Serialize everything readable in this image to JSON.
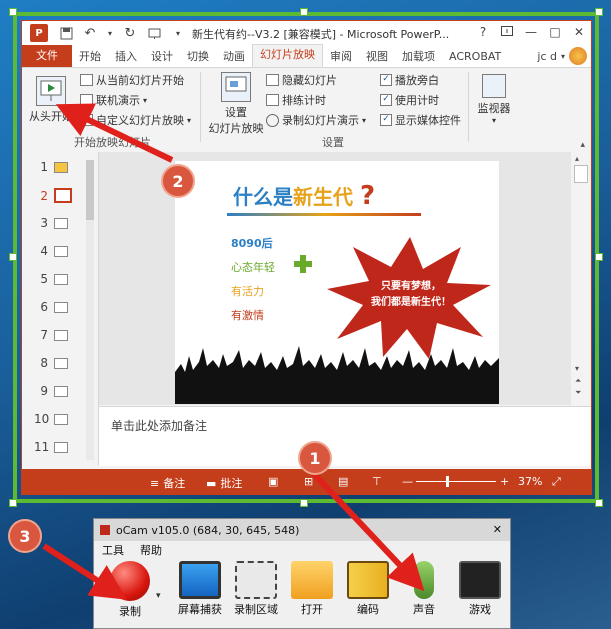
{
  "window": {
    "app_icon": "P",
    "title": "新生代有约--V3.2 [兼容模式] - Microsoft PowerP...",
    "help": "?",
    "minimize": "—",
    "maximize": "□",
    "close": "✕"
  },
  "tabs": [
    {
      "label": "文件"
    },
    {
      "label": "开始"
    },
    {
      "label": "插入"
    },
    {
      "label": "设计"
    },
    {
      "label": "切换"
    },
    {
      "label": "动画"
    },
    {
      "label": "幻灯片放映"
    },
    {
      "label": "审阅"
    },
    {
      "label": "视图"
    },
    {
      "label": "加载项"
    },
    {
      "label": "ACROBAT"
    }
  ],
  "user": {
    "name": "jc d"
  },
  "ribbon": {
    "from_start": "从头开始",
    "from_current": "从当前幻灯片开始",
    "online": "联机演示",
    "custom": "自定义幻灯片放映",
    "group1": "开始放映幻灯片",
    "setup_line1": "设置",
    "setup_line2": "幻灯片放映",
    "hide_slide": "隐藏幻灯片",
    "rehearse": "排练计时",
    "record": "录制幻灯片演示",
    "narration": "播放旁白",
    "timing": "使用计时",
    "media_controls": "显示媒体控件",
    "group2": "设置",
    "monitor": "监视器"
  },
  "thumbnails": [
    "1",
    "2",
    "3",
    "4",
    "5",
    "6",
    "7",
    "8",
    "9",
    "10",
    "11"
  ],
  "slide": {
    "title_a": "什么是",
    "title_b": "新生代",
    "title_q": "?",
    "line1": "8090后",
    "line2": "心态年轻",
    "line3": "有活力",
    "line4": "有激情",
    "burst_line1": "只要有梦想，",
    "burst_line2": "我们都是新生代！"
  },
  "notes_placeholder": "单击此处添加备注",
  "statusbar": {
    "notes": "备注",
    "comments": "批注",
    "zoom_out": "—",
    "zoom_in": "+",
    "zoom": "37%",
    "zoom_level": 0.37
  },
  "ocam": {
    "title": "oCam v105.0 (684, 30, 645, 548)",
    "close": "✕",
    "menu": [
      "工具",
      "帮助"
    ],
    "tools": [
      {
        "label": "录制"
      },
      {
        "label": "屏幕捕获"
      },
      {
        "label": "录制区域"
      },
      {
        "label": "打开"
      },
      {
        "label": "编码"
      },
      {
        "label": "声音"
      },
      {
        "label": "游戏"
      }
    ]
  },
  "annotations": {
    "step1": "1",
    "step2": "2",
    "step3": "3"
  },
  "colors": {
    "accent": "#c43e1c",
    "frame": "#5dbb33",
    "badge": "#d9573f",
    "arrow": "#e0201a"
  }
}
